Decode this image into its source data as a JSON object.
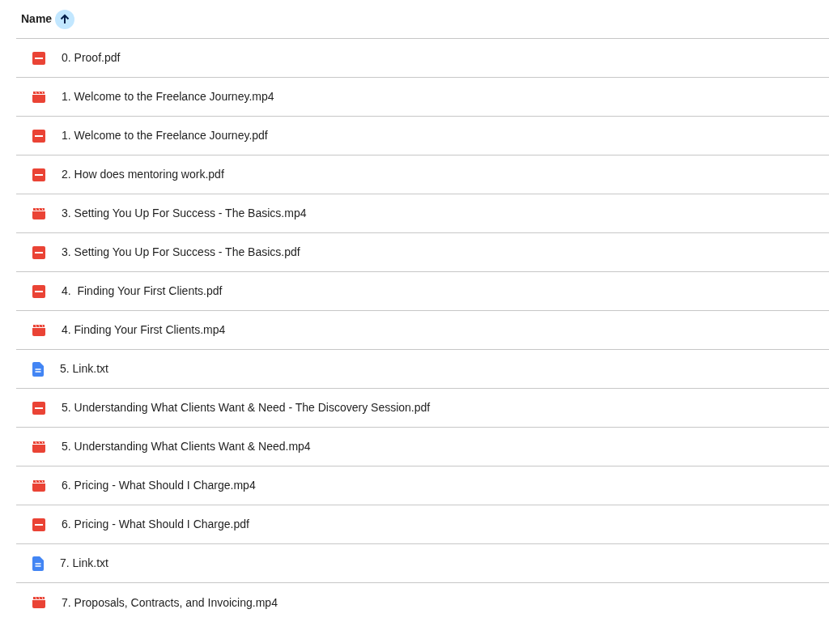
{
  "header": {
    "column": "Name",
    "sorted_ascending": true
  },
  "files": [
    {
      "name": "0. Proof.pdf",
      "kind": "pdf"
    },
    {
      "name": "1. Welcome to the Freelance Journey.mp4",
      "kind": "video"
    },
    {
      "name": "1. Welcome to the Freelance Journey.pdf",
      "kind": "pdf"
    },
    {
      "name": "2. How does mentoring work.pdf",
      "kind": "pdf"
    },
    {
      "name": "3. Setting You Up For Success - The Basics.mp4",
      "kind": "video"
    },
    {
      "name": "3. Setting You Up For Success - The Basics.pdf",
      "kind": "pdf"
    },
    {
      "name": "4.  Finding Your First Clients.pdf",
      "kind": "pdf"
    },
    {
      "name": "4. Finding Your First Clients.mp4",
      "kind": "video"
    },
    {
      "name": "5. Link.txt",
      "kind": "doc"
    },
    {
      "name": "5. Understanding What Clients Want & Need - The Discovery Session.pdf",
      "kind": "pdf"
    },
    {
      "name": "5. Understanding What Clients Want & Need.mp4",
      "kind": "video"
    },
    {
      "name": "6. Pricing - What Should I Charge.mp4",
      "kind": "video"
    },
    {
      "name": "6. Pricing - What Should I Charge.pdf",
      "kind": "pdf"
    },
    {
      "name": "7. Link.txt",
      "kind": "doc"
    },
    {
      "name": "7. Proposals, Contracts, and Invoicing.mp4",
      "kind": "video"
    }
  ]
}
